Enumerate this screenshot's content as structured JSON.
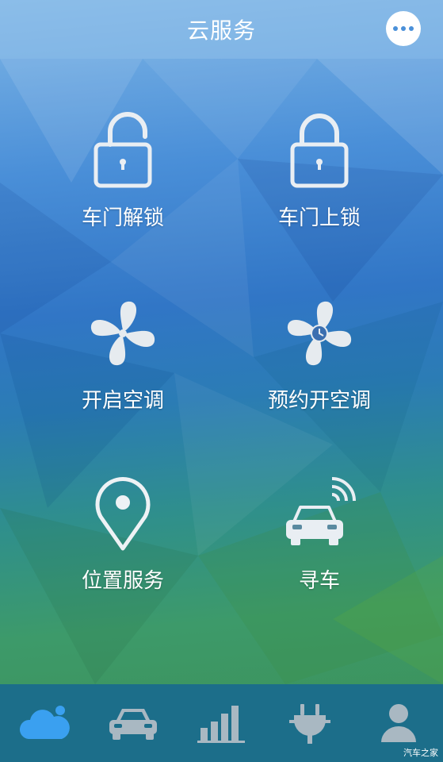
{
  "header": {
    "title": "云服务"
  },
  "tiles": [
    {
      "label": "车门解锁",
      "icon": "unlock-icon"
    },
    {
      "label": "车门上锁",
      "icon": "lock-icon"
    },
    {
      "label": "开启空调",
      "icon": "fan-icon"
    },
    {
      "label": "预约开空调",
      "icon": "fan-clock-icon"
    },
    {
      "label": "位置服务",
      "icon": "location-pin-icon"
    },
    {
      "label": "寻车",
      "icon": "car-signal-icon"
    }
  ],
  "tabs": [
    {
      "icon": "cloud-icon",
      "active": true
    },
    {
      "icon": "car-icon",
      "active": false
    },
    {
      "icon": "bar-chart-icon",
      "active": false
    },
    {
      "icon": "plug-icon",
      "active": false
    },
    {
      "icon": "user-icon",
      "active": false
    }
  ],
  "watermark": "汽车之家",
  "colors": {
    "active_tab": "#3aa0f0",
    "inactive_tab": "#9fb3bf",
    "tabbar_bg": "#1c6e8a"
  }
}
